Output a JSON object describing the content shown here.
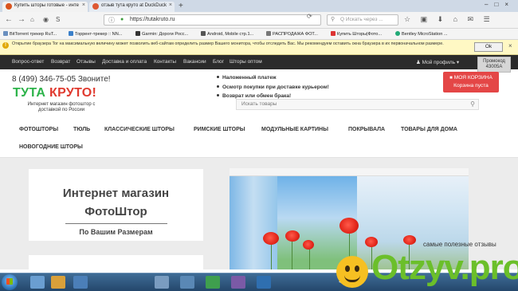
{
  "browser": {
    "tabs": [
      {
        "title": "Купить шторы готовые - инте",
        "active": true
      },
      {
        "title": "отзыв тута круто at DuckDuck",
        "active": false
      }
    ],
    "new_tab": "+",
    "address": "https://tutakruto.ru",
    "search_placeholder": "Q Искать через ...",
    "bookmarks": [
      "BitTorrent трекер RuT...",
      "Торрент-трекер :: NN...",
      "Garmin: Дороги Росс...",
      "Android, Mobile стр.1...",
      "РАСПРОДАЖА ФОТ...",
      "Купить Шторы|Фото...",
      "Bentley MicroStation ..."
    ],
    "notice_text": "Открытие браузера Tor на максимальную величину может позволить веб-сайтам определить размер Вашего монитора, чтобы отследить Вас. Мы рекомендуем оставить окна браузера в их первоначальном размере.",
    "ok_label": "Ok"
  },
  "site": {
    "topnav": [
      "Вопрос-ответ",
      "Возврат",
      "Отзывы",
      "Доставка и оплата",
      "Контакты",
      "Вакансии",
      "Блог",
      "Шторы оптом"
    ],
    "profile_label": "Мой профиль ▾",
    "promo_code": "Промокод 43005А",
    "phone": "8 (499) 346-75-05 Звоните!",
    "logo_part1": "ТУТА",
    "logo_part2": "КРУТО!",
    "tagline": "Интернет магазин фотоштор с доставкой по России",
    "features": [
      "Наложенный платеж",
      "Осмотр покупки при доставке курьером!",
      "Возврат или обмен брака!"
    ],
    "cart_title": "МОЯ КОРЗИНА",
    "cart_status": "Корзина пуста",
    "search_placeholder": "Искать товары",
    "categories": [
      "ФОТОШТОРЫ",
      "ТЮЛЬ",
      "КЛАССИЧЕСКИЕ ШТОРЫ",
      "РИМСКИЕ ШТОРЫ",
      "МОДУЛЬНЫЕ КАРТИНЫ",
      "ПОКРЫВАЛА",
      "ТОВАРЫ ДЛЯ ДОМА",
      "НОВОГОДНИЕ ШТОРЫ"
    ],
    "hero_line1": "Интернет магазин",
    "hero_line2": "ФотоШтор",
    "hero_line3": "По Вашим Размерам"
  },
  "watermark": {
    "caption": "самые полезные отзывы",
    "logo": "Otzyv.pro"
  },
  "icons": {
    "back": "back-arrow-icon",
    "forward": "forward-arrow-icon",
    "lock": "lock-icon",
    "search": "search-icon",
    "cart": "cart-icon",
    "user": "user-icon"
  },
  "colors": {
    "logo_green": "#2db34a",
    "logo_red": "#e03a2f",
    "cart_red": "#e44646",
    "topnav_bg": "#2b2b2b",
    "notice_bg": "#fff8c4"
  }
}
